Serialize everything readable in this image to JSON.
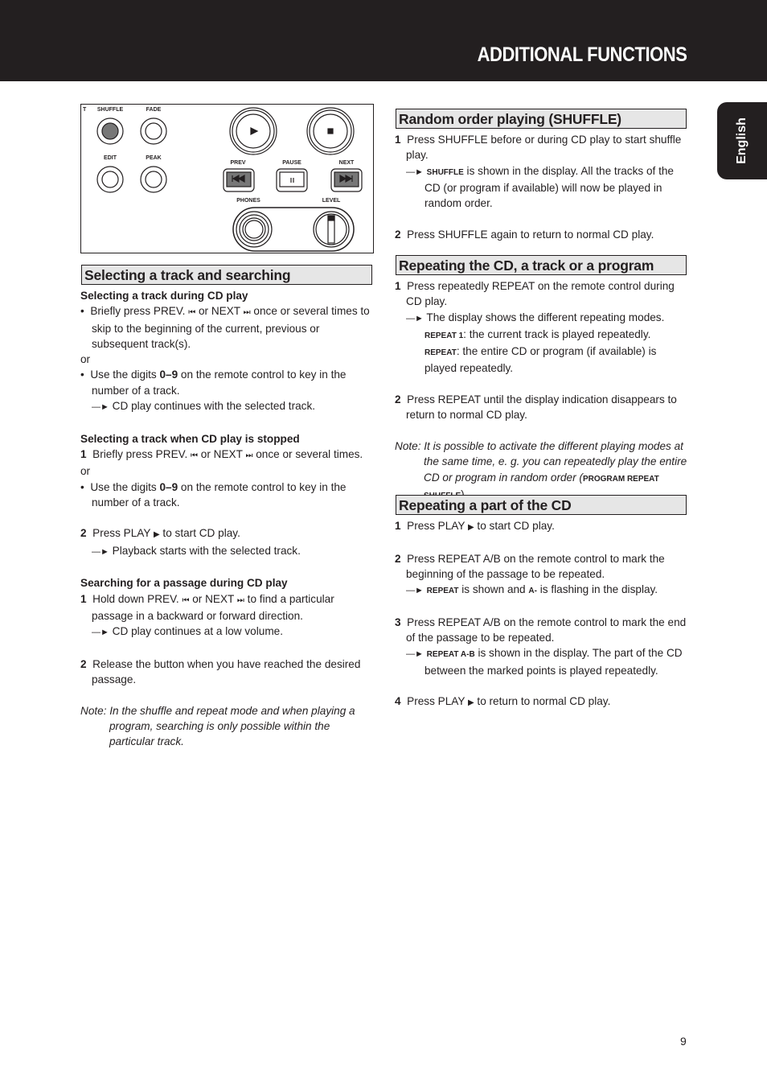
{
  "header": {
    "title": "ADDITIONAL FUNCTIONS"
  },
  "language_tab": "English",
  "panel": {
    "labels": {
      "cut": "T",
      "shuffle": "SHUFFLE",
      "fade": "FADE",
      "edit": "EDIT",
      "peak": "PEAK",
      "prev": "PREV",
      "pause": "PAUSE",
      "next": "NEXT",
      "phones": "PHONES",
      "level": "LEVEL"
    }
  },
  "glyphs": {
    "arrow": "—►",
    "prev": "⏮",
    "next": "⏭",
    "play": "▶",
    "bullet": "•"
  },
  "left": {
    "section_title": "Selecting a track and searching",
    "s1": {
      "title": "Selecting a track during CD play",
      "b1": [
        "Briefly press PREV. ",
        " or NEXT  ",
        " once or several times to skip to the beginning of the current, previous or subsequent track(s)."
      ],
      "or": "or",
      "b2": [
        "Use the digits ",
        "0–9",
        " on the remote control to key in the number of a track."
      ],
      "r1": "CD play continues with the selected track."
    },
    "s2": {
      "title": "Selecting a track when CD play is stopped",
      "st1": [
        "1",
        "Briefly press PREV. ",
        " or NEXT ",
        " once or several times."
      ],
      "or": "or",
      "b1": [
        "Use the digits ",
        "0–9",
        " on the remote control to key in the number of a track."
      ],
      "st2": [
        "2",
        "Press PLAY ",
        " to start CD play."
      ],
      "r2": "Playback starts with the selected track."
    },
    "s3": {
      "title": "Searching for a passage during CD play",
      "st1": [
        "1",
        "Hold down PREV. ",
        " or NEXT ",
        " to find a particular passage in a backward or forward direction."
      ],
      "r1": "CD play continues at a low volume.",
      "st2": [
        "2",
        "Release the button when you have reached the desired passage."
      ],
      "note": "Note: In the shuffle and repeat mode and when playing a program, searching is only possible within the particular track."
    }
  },
  "right": {
    "shuffle": {
      "title": "Random order playing (SHUFFLE)",
      "st1": [
        "1",
        "Press SHUFFLE before or during CD play to start shuffle play."
      ],
      "r1": [
        "SHUFFLE",
        " is shown in the display. All the tracks of the CD (or program if available) will now be played in random order."
      ],
      "st2": [
        "2",
        "Press SHUFFLE again to return to normal CD play."
      ]
    },
    "repeat": {
      "title": "Repeating the CD, a track or a program",
      "st1": [
        "1",
        "Press repeatedly REPEAT on the remote control during CD play."
      ],
      "r1": "The display shows the different repeating modes.",
      "m1": [
        "REPEAT 1",
        ": the current track is played repeatedly."
      ],
      "m2": [
        "REPEAT",
        ": the entire CD or program (if available) is played repeatedly."
      ],
      "st2": [
        "2",
        "Press REPEAT until the display indication disappears to return to normal CD play."
      ],
      "note": [
        "Note: It is possible to activate the different playing modes at the same time, e. g. you can repeatedly play the entire CD or program in random order (",
        "PROGRAM REPEAT SHUFFLE",
        ")."
      ]
    },
    "ab": {
      "title": "Repeating a part of the CD",
      "st1": [
        "1",
        "Press PLAY ",
        " to start CD play."
      ],
      "st2": [
        "2",
        "Press REPEAT A/B on the remote control to mark the beginning of the passage to be repeated."
      ],
      "r2": [
        "REPEAT",
        " is shown and ",
        "A-",
        " is flashing in the display."
      ],
      "st3": [
        "3",
        "Press REPEAT A/B on the remote control to mark the end of the passage to be repeated."
      ],
      "r3": [
        "REPEAT A-B",
        " is shown in the display. The part of the CD between the marked points is played repeatedly."
      ],
      "st4": [
        "4",
        "Press PLAY ",
        " to return to normal CD play."
      ]
    }
  },
  "page_number": "9"
}
